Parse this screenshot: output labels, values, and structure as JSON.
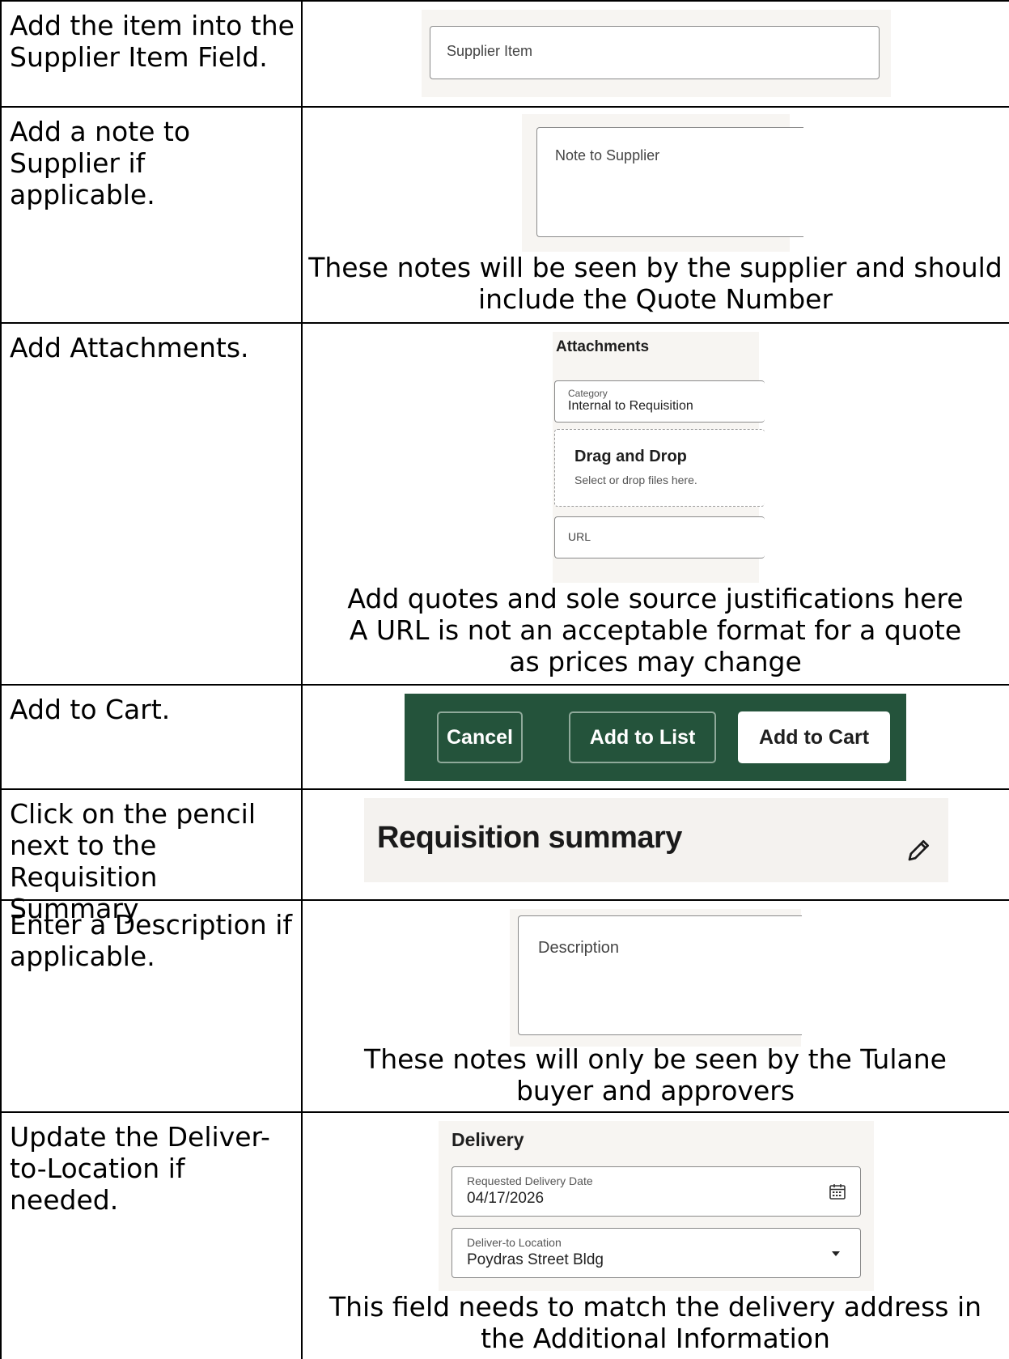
{
  "rows": [
    {
      "instruction": "Add the item into the Supplier Item Field.",
      "supplier_item_label": "Supplier Item"
    },
    {
      "instruction": "Add a note to Supplier if applicable.",
      "note_field_label": "Note to Supplier",
      "caption": "These notes will be seen by the supplier and should include the Quote Number"
    },
    {
      "instruction": "Add Attachments.",
      "section_title": "Attachments",
      "category_label": "Category",
      "category_value": "Internal to Requisition",
      "drop_title": "Drag and Drop",
      "drop_hint": "Select or drop files here.",
      "url_label": "URL",
      "caption_line1": "Add quotes and sole source justifications here",
      "caption_line2": "A URL is not an acceptable format for a quote as prices may change"
    },
    {
      "instruction": "Add to Cart.",
      "cancel_label": "Cancel",
      "add_to_list_label": "Add to List",
      "add_to_cart_label": "Add to Cart"
    },
    {
      "instruction": "Click on the pencil next to the Requisition Summary",
      "summary_title": "Requisition summary",
      "edit_icon": "pencil-icon"
    },
    {
      "instruction": "Enter a Description if applicable.",
      "description_label": "Description",
      "caption": "These notes will only be seen by the Tulane buyer and approvers"
    },
    {
      "instruction": "Update the Deliver-to-Location if needed.",
      "section_title": "Delivery",
      "date_label": "Requested Delivery Date",
      "date_value": "04/17/2026",
      "calendar_icon": "calendar-icon",
      "location_label": "Deliver-to Location",
      "location_value": "Poydras Street Bldg",
      "dropdown_icon": "caret-down-icon",
      "caption": "This field needs to match the delivery address in the Additional Information"
    }
  ],
  "colors": {
    "button_bar": "#24533b",
    "screenshot_bg": "#f7f5f2"
  }
}
